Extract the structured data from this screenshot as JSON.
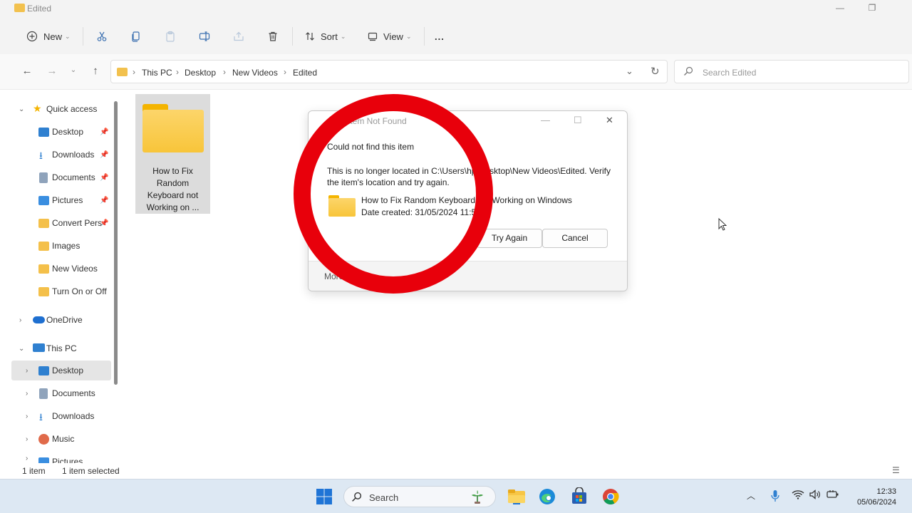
{
  "window": {
    "title": "Edited"
  },
  "toolbar": {
    "new_label": "New",
    "sort_label": "Sort",
    "view_label": "View",
    "more_label": "..."
  },
  "address": {
    "crumbs": [
      "This PC",
      "Desktop",
      "New Videos",
      "Edited"
    ]
  },
  "search": {
    "placeholder": "Search Edited"
  },
  "sidebar": {
    "quick_access": "Quick access",
    "items": [
      {
        "label": "Desktop",
        "pinned": true
      },
      {
        "label": "Downloads",
        "pinned": true
      },
      {
        "label": "Documents",
        "pinned": true
      },
      {
        "label": "Pictures",
        "pinned": true
      },
      {
        "label": "Convert Pers",
        "pinned": true
      },
      {
        "label": "Images"
      },
      {
        "label": "New Videos"
      },
      {
        "label": "Turn On or Off"
      }
    ],
    "onedrive": "OneDrive",
    "this_pc": "This PC",
    "pc_items": [
      "Desktop",
      "Documents",
      "Downloads",
      "Music",
      "Pictures"
    ]
  },
  "files": [
    {
      "name": "How to Fix Random Keyboard not Working on ..."
    }
  ],
  "dialog": {
    "title": "Item Not Found",
    "heading": "Could not find this item",
    "message": "This is no longer located in C:\\Users\\hp\\Desktop\\New Videos\\Edited. Verify the item's location and try again.",
    "item_name": "How to Fix Random Keyboard not Working on Windows",
    "item_date": "Date created: 31/05/2024 11:51",
    "try_again_label": "Try Again",
    "cancel_label": "Cancel",
    "more_details_label": "More details"
  },
  "status": {
    "count": "1 item",
    "selection": "1 item selected"
  },
  "taskbar": {
    "search_label": "Search",
    "time": "12:33",
    "date": "05/06/2024"
  },
  "colors": {
    "accent": "#0067c0",
    "folder": "#f8c53a",
    "highlight_circle": "#e8000b",
    "taskbar": "#dde8f3"
  }
}
